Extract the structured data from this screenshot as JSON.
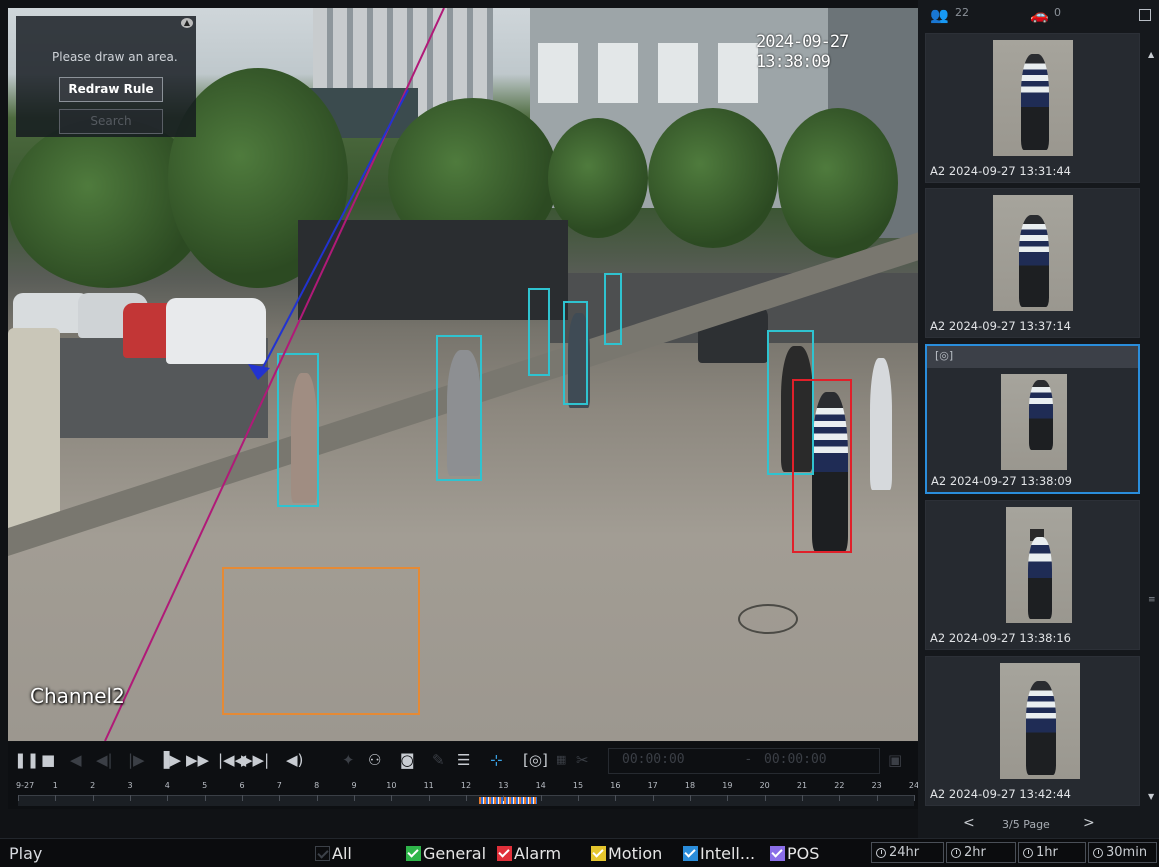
{
  "video": {
    "timestamp": "2024-09-27 13:38:09",
    "channel_label": "Channel2"
  },
  "draw_panel": {
    "prompt": "Please draw an area.",
    "redraw_label": "Redraw Rule",
    "search_label": "Search"
  },
  "toolbar": {
    "start_time": "00:00:00",
    "separator": "-",
    "end_time": "00:00:00",
    "icons": [
      "pause-icon",
      "stop-icon",
      "reverse-play-icon",
      "slow-backward-icon",
      "step-forward-icon",
      "slow-play-icon",
      "fast-forward-icon",
      "previous-record-icon",
      "next-record-icon",
      "volume-icon",
      "smart-search-icon",
      "face-detect-icon",
      "snapshot-icon",
      "tag-icon",
      "filter-icon",
      "motion-search-icon",
      "object-search-icon",
      "dots-icon",
      "clip-icon",
      "save-icon"
    ]
  },
  "timeline": {
    "labels": [
      "9-27",
      "1",
      "2",
      "3",
      "4",
      "5",
      "6",
      "7",
      "8",
      "9",
      "10",
      "11",
      "12",
      "13",
      "14",
      "15",
      "16",
      "17",
      "18",
      "19",
      "20",
      "21",
      "22",
      "23",
      "24"
    ]
  },
  "bottom": {
    "mode": "Play",
    "filters": [
      {
        "label": "All",
        "color": "#3c4148",
        "checked": false
      },
      {
        "label": "General",
        "color": "#2fb54a",
        "checked": true
      },
      {
        "label": "Alarm",
        "color": "#e0303a",
        "checked": true
      },
      {
        "label": "Motion",
        "color": "#e5c52d",
        "checked": true
      },
      {
        "label": "Intell...",
        "color": "#2a8ddb",
        "checked": true
      },
      {
        "label": "POS",
        "color": "#8a6ee8",
        "checked": true
      }
    ],
    "ranges": [
      "24hr",
      "2hr",
      "1hr",
      "30min"
    ]
  },
  "right_panel": {
    "human_count": "22",
    "vehicle_count": "0",
    "cards": [
      {
        "label": "A2 2024-09-27 13:31:44",
        "selected": false
      },
      {
        "label": "A2 2024-09-27 13:37:14",
        "selected": false
      },
      {
        "label": "A2 2024-09-27 13:38:09",
        "selected": true
      },
      {
        "label": "A2 2024-09-27 13:38:16",
        "selected": false
      },
      {
        "label": "A2 2024-09-27 13:42:44",
        "selected": false
      }
    ],
    "page": "3/5 Page",
    "prev": "<",
    "next": ">"
  },
  "colors": {
    "accent": "#2a8ddb",
    "detection_box": "#2fc3d0",
    "highlight_box": "#e0202a",
    "rule_box": "#e58a35"
  }
}
